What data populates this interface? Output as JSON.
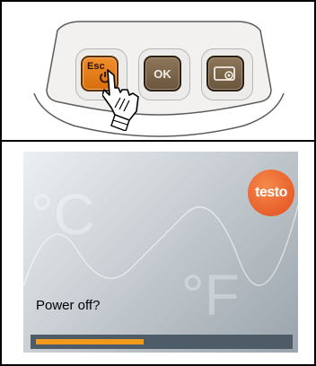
{
  "keypad": {
    "esc_label": "Esc",
    "ok_label": "OK",
    "icons": [
      "power-icon",
      "camera-icon",
      "pointer-hand-icon"
    ]
  },
  "screen": {
    "logo_text": "testo",
    "prompt": "Power off?",
    "watermark_units": [
      "°C",
      "°F"
    ],
    "progress_fraction": 0.43
  },
  "colors": {
    "esc_button": "#e97e1a",
    "ok_button": "#7a654b",
    "logo": "#e8562a",
    "progress_fill": "#f09a1e",
    "progress_track": "#4d5c66"
  }
}
